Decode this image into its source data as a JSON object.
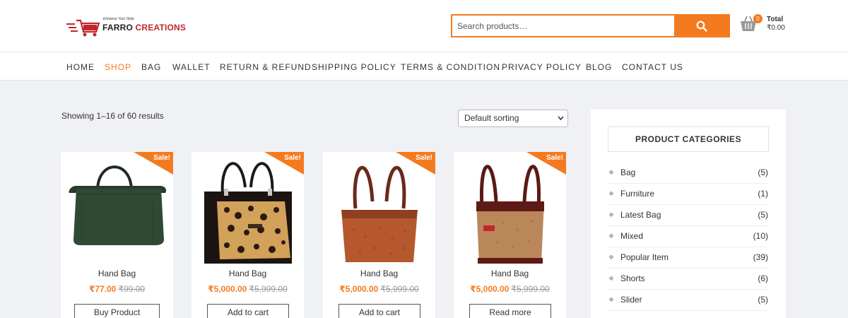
{
  "header": {
    "logo": {
      "tagline": "Enhance Your Style",
      "name_part1": "FARRO ",
      "name_part2": "CREATIONS"
    },
    "search": {
      "placeholder": "Search products…",
      "value": ""
    },
    "cart": {
      "count": "0",
      "total_label": "Total",
      "total_value": "₹0.00"
    }
  },
  "nav": {
    "items": [
      {
        "label": "HOME"
      },
      {
        "label": "SHOP"
      },
      {
        "label": "BAG"
      },
      {
        "label": "WALLET"
      },
      {
        "label": "RETURN & REFUND"
      },
      {
        "label": "SHIPPING POLICY"
      },
      {
        "label": "TERMS & CONDITION"
      },
      {
        "label": "PRIVACY POLICY"
      },
      {
        "label": "BLOG"
      },
      {
        "label": "CONTACT US"
      }
    ]
  },
  "shop": {
    "results_text": "Showing 1–16 of 60 results",
    "sort_value": "Default sorting"
  },
  "products": [
    {
      "title": "Hand Bag",
      "sale": "Sale!",
      "price": "₹77.00",
      "old_price": "₹99.00",
      "button": "Buy Product"
    },
    {
      "title": "Hand Bag",
      "sale": "Sale!",
      "price": "₹5,000.00",
      "old_price": "₹5,999.00",
      "button": "Add to cart"
    },
    {
      "title": "Hand Bag",
      "sale": "Sale!",
      "price": "₹5,000.00",
      "old_price": "₹5,999.00",
      "button": "Add to cart"
    },
    {
      "title": "Hand Bag",
      "sale": "Sale!",
      "price": "₹5,000.00",
      "old_price": "₹5,999.00",
      "button": "Read more"
    }
  ],
  "sidebar": {
    "title": "PRODUCT CATEGORIES",
    "categories": [
      {
        "name": "Bag",
        "count": "(5)"
      },
      {
        "name": "Furniture",
        "count": "(1)"
      },
      {
        "name": "Latest Bag",
        "count": "(5)"
      },
      {
        "name": "Mixed",
        "count": "(10)"
      },
      {
        "name": "Popular Item",
        "count": "(39)"
      },
      {
        "name": "Shorts",
        "count": "(6)"
      },
      {
        "name": "Slider",
        "count": "(5)"
      }
    ]
  },
  "colors": {
    "accent": "#f47a20",
    "brand_red": "#c0272d",
    "page_bg": "#f0f1f5"
  }
}
